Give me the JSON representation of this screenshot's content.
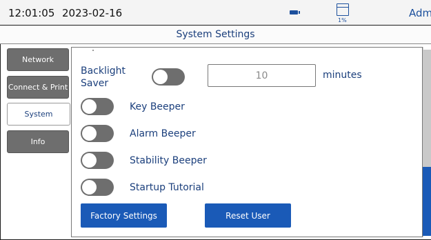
{
  "status_bar": {
    "time": "12:01:05",
    "date": "2023-02-16",
    "battery_icon": "battery-icon",
    "storage_icon": "storage-icon",
    "storage_percent": "1%",
    "user": "Admin"
  },
  "page": {
    "title": "System Settings"
  },
  "tabs": [
    {
      "label": "Network",
      "active": false
    },
    {
      "label": "Connect & Print",
      "active": false
    },
    {
      "label": "System",
      "active": true
    },
    {
      "label": "Info",
      "active": false
    }
  ],
  "settings": {
    "backlight_saver": {
      "label_line1": "Backlight",
      "label_line2": "Saver",
      "enabled": false,
      "minutes_value": "10",
      "unit": "minutes"
    },
    "key_beeper": {
      "label": "Key Beeper",
      "enabled": false
    },
    "alarm_beeper": {
      "label": "Alarm Beeper",
      "enabled": false
    },
    "stability_beeper": {
      "label": "Stability Beeper",
      "enabled": false
    },
    "startup_tutorial": {
      "label": "Startup Tutorial",
      "enabled": false
    }
  },
  "buttons": {
    "factory_settings": "Factory Settings",
    "reset_user": "Reset User"
  },
  "colors": {
    "accent": "#1a5ab7",
    "toggle_off": "#6e6e6e",
    "text_primary": "#1b3f7c"
  }
}
